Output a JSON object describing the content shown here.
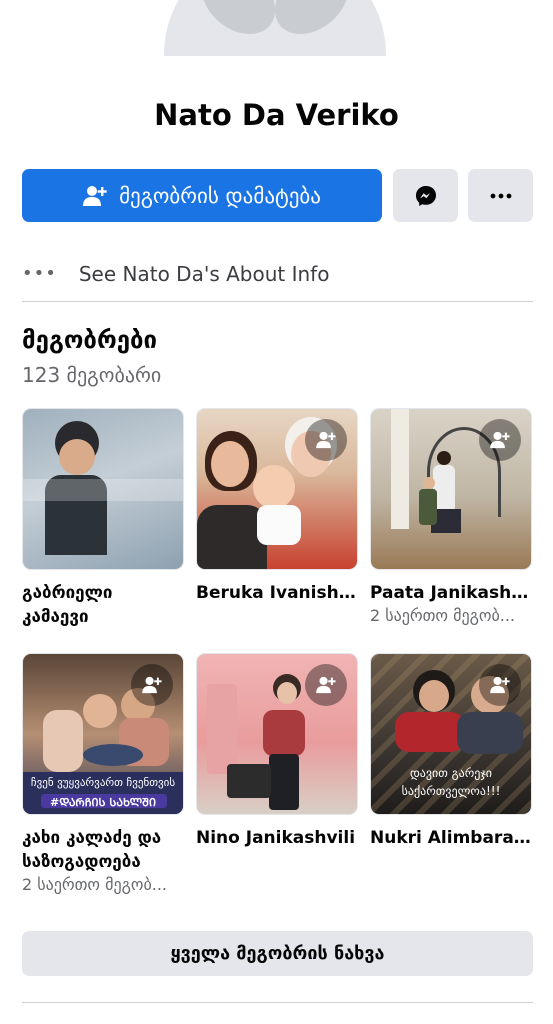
{
  "profile": {
    "name": "Nato Da Veriko"
  },
  "actions": {
    "add_friend_label": "მეგობრის დამატება",
    "messenger_icon": "messenger-icon",
    "more_icon": "more-icon"
  },
  "about": {
    "label": "See Nato Da's About Info"
  },
  "friends": {
    "title": "მეგობრები",
    "count": "123 მეგობარი",
    "items": [
      {
        "name": "გაბრიელი კამაევი",
        "mutual": "",
        "show_add": false
      },
      {
        "name": "Beruka Ivanishvili",
        "mutual": "",
        "show_add": true
      },
      {
        "name": "Paata Janikashvili",
        "mutual": "2 საერთო მეგობ...",
        "show_add": true
      },
      {
        "name": "კახი კალაძე და საზოგადოება",
        "mutual": "2 საერთო მეგობ...",
        "show_add": true,
        "photo_caption_1": "ჩვენ ვუყვარვართ ჩვენთვის",
        "photo_caption_2": "#ᲓᲐᲠᲩᲘᲡ ᲡᲐᲮᲚᲨᲘ"
      },
      {
        "name": "Nino Janikashvili",
        "mutual": "",
        "show_add": true
      },
      {
        "name": "Nukri Alimbarashvili",
        "mutual": "",
        "show_add": true,
        "photo_caption_1": "დავით გარეჯი",
        "photo_caption_2": "საქართველოა!!!"
      }
    ]
  },
  "see_all": {
    "label": "ყველა მეგობრის ნახვა"
  },
  "colors": {
    "primary": "#1b74e4",
    "secondary_bg": "#e4e6eb",
    "muted_text": "#65676b"
  }
}
